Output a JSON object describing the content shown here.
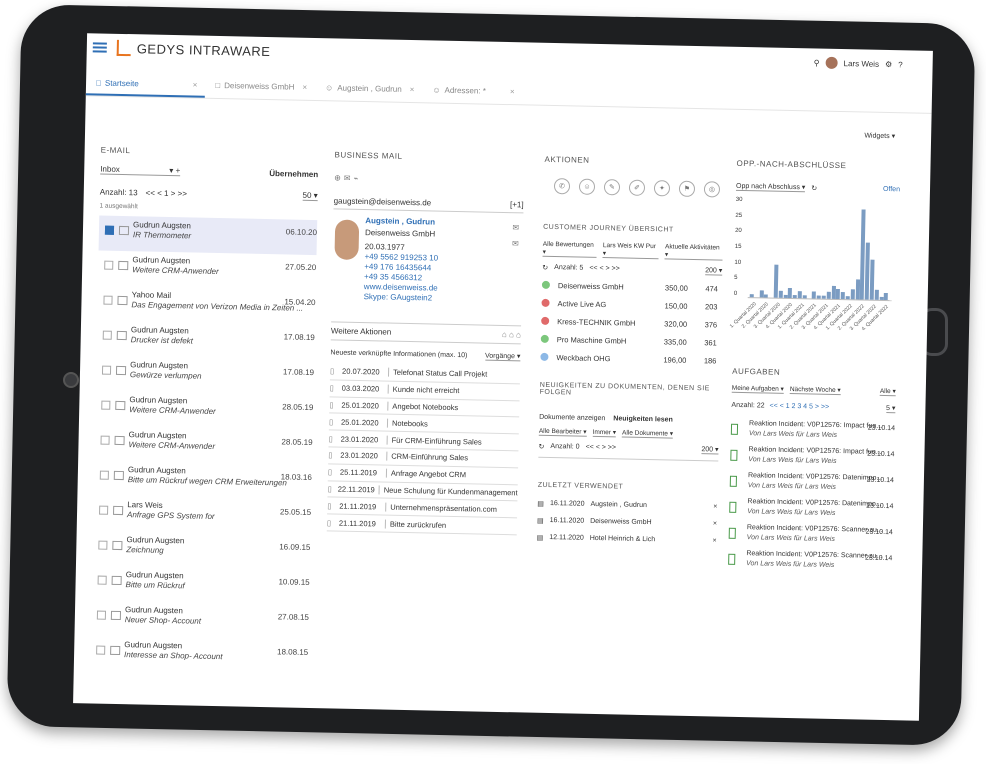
{
  "app": {
    "brand": "GEDYS INTRAWARE",
    "user": "Lars Weis",
    "colors": {
      "accent": "#2f6fb5",
      "brand": "#e8741f"
    }
  },
  "tabs": [
    {
      "label": "Startseite",
      "active": true
    },
    {
      "label": "Deisenweiss GmbH"
    },
    {
      "label": "Augstein , Gudrun"
    },
    {
      "label": "Adressen: *"
    }
  ],
  "widgets_label": "Widgets",
  "email": {
    "title": "E-MAIL",
    "folder": "Inbox",
    "takeover": "Übernehmen",
    "count": "Anzahl: 13",
    "pager": "<< < 1 > >>",
    "page_size": "50",
    "selected": "1 ausgewählt",
    "items": [
      {
        "name": "Gudrun Augsten",
        "subject": "IR Thermometer",
        "date": "06.10.20",
        "selected": true
      },
      {
        "name": "Gudrun Augsten",
        "subject": "Weitere CRM-Anwender",
        "date": "27.05.20"
      },
      {
        "name": "Yahoo Mail",
        "subject": "Das Engagement von Verizon Media in Zeiten ...",
        "date": "15.04.20"
      },
      {
        "name": "Gudrun Augsten",
        "subject": "Drucker ist defekt",
        "date": "17.08.19"
      },
      {
        "name": "Gudrun Augsten",
        "subject": "Gewürze verlumpen",
        "date": "17.08.19"
      },
      {
        "name": "Gudrun Augsten",
        "subject": "Weitere CRM-Anwender",
        "date": "28.05.19"
      },
      {
        "name": "Gudrun Augsten",
        "subject": "Weitere CRM-Anwender",
        "date": "28.05.19"
      },
      {
        "name": "Gudrun Augsten",
        "subject": "Bitte um Rückruf wegen CRM Erweiterungen",
        "date": "18.03.16"
      },
      {
        "name": "Lars Weis",
        "subject": "Anfrage GPS System for",
        "date": "25.05.15"
      },
      {
        "name": "Gudrun Augsten",
        "subject": "Zeichnung",
        "date": "16.09.15"
      },
      {
        "name": "Gudrun Augsten",
        "subject": "Bitte um Rückruf",
        "date": "10.09.15"
      },
      {
        "name": "Gudrun Augsten",
        "subject": "Neuer Shop- Account",
        "date": "27.08.15"
      },
      {
        "name": "Gudrun Augsten",
        "subject": "Interesse an Shop- Account",
        "date": "18.08.15"
      }
    ]
  },
  "business": {
    "title": "BUSINESS MAIL",
    "email": "gaugstein@deisenweiss.de",
    "counter": "[+1]",
    "contact_name": "Augstein , Gudrun",
    "company": "Deisenweiss GmbH",
    "birthday": "20.03.1977",
    "phones": [
      "+49 5562 919253 10",
      "+49 176 16435644",
      "+49 35 4566312"
    ],
    "website": "www.deisenweiss.de",
    "skype": "Skype: GAugstein2",
    "more_actions": "Weitere Aktionen",
    "history_title": "Neueste verknüpfte Informationen (max. 10)",
    "history_filter": "Vorgänge",
    "history": [
      {
        "date": "20.07.2020",
        "text": "Telefonat Status Call Projekt"
      },
      {
        "date": "03.03.2020",
        "text": "Kunde nicht erreicht"
      },
      {
        "date": "25.01.2020",
        "text": "Angebot Notebooks"
      },
      {
        "date": "25.01.2020",
        "text": "Notebooks"
      },
      {
        "date": "23.01.2020",
        "text": "Für CRM-Einführung Sales"
      },
      {
        "date": "23.01.2020",
        "text": "CRM-Einführung Sales"
      },
      {
        "date": "25.11.2019",
        "text": "Anfrage Angebot CRM"
      },
      {
        "date": "22.11.2019",
        "text": "Neue Schulung für Kundenmanagement"
      },
      {
        "date": "21.11.2019",
        "text": "Unternehmenspräsentation.com"
      },
      {
        "date": "21.11.2019",
        "text": "Bitte zurückrufen"
      }
    ]
  },
  "actions": {
    "title": "AKTIONEN"
  },
  "journey": {
    "title": "CUSTOMER JOURNEY ÜBERSICHT",
    "filters": [
      "Alle Bewertungen",
      "Lars Weis KW Pur",
      "Aktuelle Aktivitäten"
    ],
    "count": "Anzahl: 5",
    "pager": "<< < > >>",
    "page_size": "200",
    "items": [
      {
        "name": "Deisenweiss GmbH",
        "v1": "350,00",
        "v2": "474",
        "color": "#7cc77c"
      },
      {
        "name": "Active Live AG",
        "v1": "150,00",
        "v2": "203",
        "color": "#e06a6a"
      },
      {
        "name": "Kress-TECHNIK GmbH",
        "v1": "320,00",
        "v2": "376",
        "color": "#e06a6a"
      },
      {
        "name": "Pro Maschine GmbH",
        "v1": "335,00",
        "v2": "361",
        "color": "#7cc77c"
      },
      {
        "name": "Weckbach OHG",
        "v1": "196,00",
        "v2": "186",
        "color": "#8cb8e6"
      }
    ]
  },
  "docs": {
    "title": "NEUIGKEITEN ZU DOKUMENTEN, DENEN SIE FOLGEN",
    "tab1": "Dokumente anzeigen",
    "tab2": "Neuigkeiten lesen",
    "filters": [
      "Alle Bearbeiter",
      "Immer",
      "Alle Dokumente"
    ],
    "count": "Anzahl: 0",
    "pager": "<< < > >>",
    "page_size": "200"
  },
  "recent": {
    "title": "ZULETZT VERWENDET",
    "items": [
      {
        "date": "16.11.2020",
        "text": "Augstein , Gudrun"
      },
      {
        "date": "16.11.2020",
        "text": "Deisenweiss GmbH"
      },
      {
        "date": "12.11.2020",
        "text": "Hotel Heinrich & Lich"
      }
    ]
  },
  "opp": {
    "title": "OPP.-NACH-ABSCHLÜSSE",
    "filter": "Opp nach Abschluss",
    "link": "Offen",
    "y_ticks": [
      "30",
      "25",
      "20",
      "15",
      "10",
      "5",
      "0"
    ]
  },
  "chart_data": {
    "type": "bar",
    "categories": [
      "1. Quartal 2020",
      "2. Quartal 2020",
      "3. Quartal 2020",
      "4. Quartal 2020",
      "1. Quartal 2021",
      "2. Quartal 2021",
      "3. Quartal 2021",
      "4. Quartal 2021",
      "1. Quartal 2022",
      "2. Quartal 2022",
      "3. Quartal 2022",
      "4. Quartal 2022"
    ],
    "values": [
      1,
      0,
      2,
      1,
      0,
      10,
      2,
      1,
      3,
      1,
      2,
      1,
      0,
      2,
      1,
      1,
      2,
      4,
      3,
      2,
      1,
      3,
      6,
      27,
      17,
      12,
      3,
      1,
      2
    ],
    "ylim": [
      0,
      30
    ]
  },
  "tasks": {
    "title": "AUFGABEN",
    "filter": "Meine Aufgaben",
    "filter2": "Nächste Woche",
    "filter3": "Alle",
    "count": "Anzahl: 22",
    "pager": "<< < 1 2 3 4 5 > >>",
    "page_size": "5",
    "items": [
      {
        "t1": "Reaktion Incident: V0P12576: Impact fun...",
        "t2": "Von Lars Weis für Lars Weis",
        "date": "23.10.14"
      },
      {
        "t1": "Reaktion Incident: V0P12576: Impact fun...",
        "t2": "Von Lars Weis für Lars Weis",
        "date": "23.10.14"
      },
      {
        "t1": "Reaktion Incident: V0P12576: Datenimpo...",
        "t2": "Von Lars Weis für Lars Weis",
        "date": "23.10.14"
      },
      {
        "t1": "Reaktion Incident: V0P12576: Datenimpo...",
        "t2": "Von Lars Weis für Lars Weis",
        "date": "23.10.14"
      },
      {
        "t1": "Reaktion Incident: V0P12576: Scanner zu...",
        "t2": "Von Lars Weis für Lars Weis",
        "date": "23.10.14"
      },
      {
        "t1": "Reaktion Incident: V0P12576: Scanner zu...",
        "t2": "Von Lars Weis für Lars Weis",
        "date": "23.10.14"
      }
    ]
  }
}
